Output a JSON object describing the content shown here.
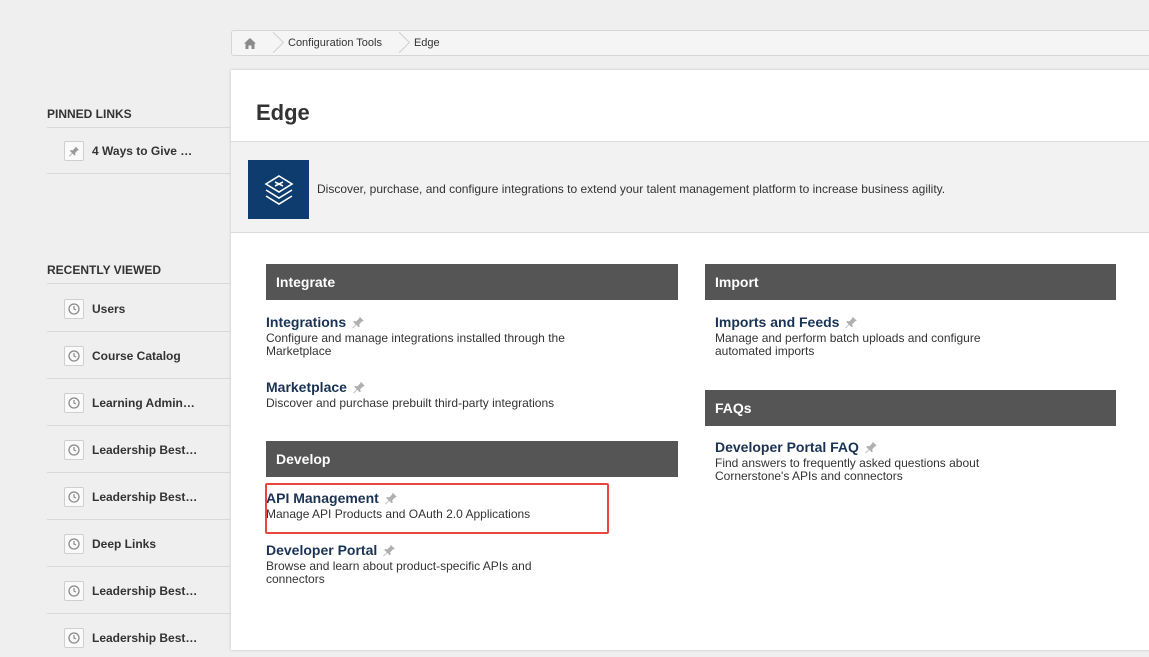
{
  "breadcrumb": {
    "home_icon": "home-icon",
    "items": [
      "Configuration Tools",
      "Edge"
    ]
  },
  "sidebar": {
    "pinned_heading": "PINNED LINKS",
    "pinned": [
      {
        "label": "4 Ways to Give …",
        "icon": "pin-icon"
      }
    ],
    "recent_heading": "RECENTLY VIEWED",
    "recent": [
      {
        "label": "Users",
        "icon": "clock-icon"
      },
      {
        "label": "Course Catalog",
        "icon": "clock-icon"
      },
      {
        "label": "Learning Admin…",
        "icon": "clock-icon"
      },
      {
        "label": "Leadership Best…",
        "icon": "clock-icon"
      },
      {
        "label": "Leadership Best…",
        "icon": "clock-icon"
      },
      {
        "label": "Deep Links",
        "icon": "clock-icon"
      },
      {
        "label": "Leadership Best…",
        "icon": "clock-icon"
      },
      {
        "label": "Leadership Best…",
        "icon": "clock-icon"
      }
    ]
  },
  "main": {
    "title": "Edge",
    "banner_text": "Discover, purchase, and configure integrations to extend your talent management platform to increase business agility.",
    "sections": {
      "integrate": {
        "heading": "Integrate",
        "links": [
          {
            "title": "Integrations",
            "desc_1": "Configure and manage integrations installed through the",
            "desc_2": "Marketplace"
          },
          {
            "title": "Marketplace",
            "desc_1": "Discover and purchase prebuilt third-party integrations"
          }
        ]
      },
      "develop": {
        "heading": "Develop",
        "links": [
          {
            "title": "API Management",
            "desc_1": "Manage API Products and OAuth 2.0 Applications"
          },
          {
            "title": "Developer Portal",
            "desc_1": "Browse and learn about product-specific APIs and",
            "desc_2": "connectors"
          }
        ]
      },
      "import": {
        "heading": "Import",
        "links": [
          {
            "title": "Imports and Feeds",
            "desc_1": "Manage and perform batch uploads and configure",
            "desc_2": "automated imports"
          }
        ]
      },
      "faqs": {
        "heading": "FAQs",
        "links": [
          {
            "title": "Developer Portal FAQ",
            "desc_1": "Find answers to frequently asked questions about",
            "desc_2": "Cornerstone's APIs and connectors"
          }
        ]
      }
    }
  },
  "colors": {
    "link_title": "#1a3355",
    "section_header": "#555555",
    "banner_icon_bg": "#0e3c6e",
    "highlight_border": "#e8463f"
  }
}
